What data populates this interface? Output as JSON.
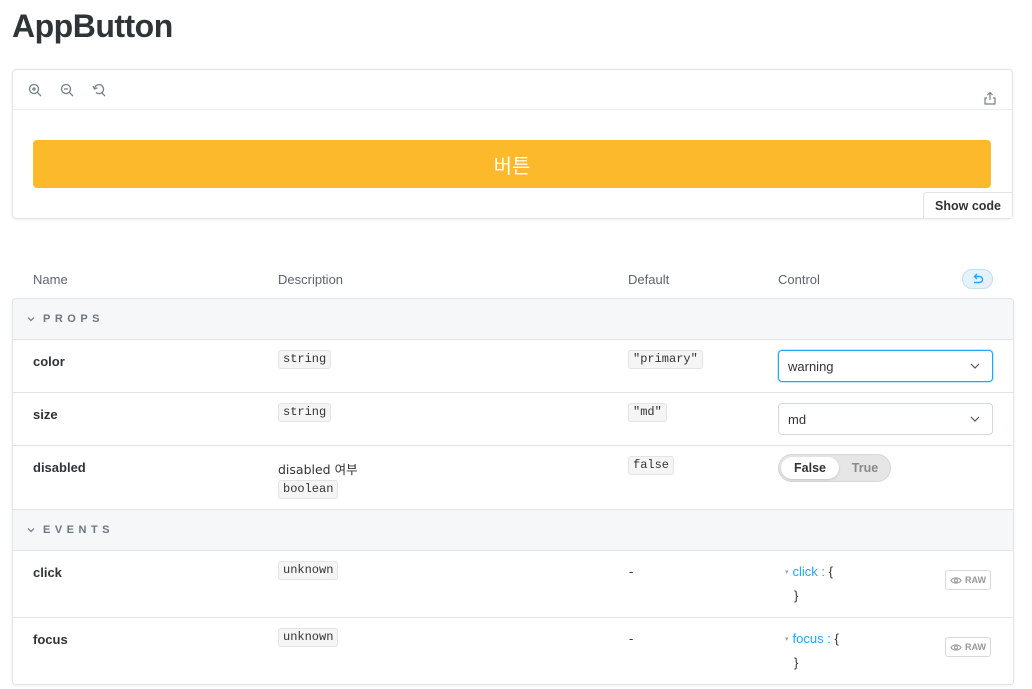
{
  "page": {
    "title": "AppButton"
  },
  "canvas": {
    "toolbar": {
      "zoom_in": "zoom-in-icon",
      "zoom_out": "zoom-out-icon",
      "reset_zoom": "reset-zoom-icon",
      "share": "share-icon"
    },
    "preview_button_label": "버튼",
    "show_code_label": "Show code",
    "colors": {
      "button_bg": "#fdb92c",
      "accent": "#1ea7fd"
    }
  },
  "argstable": {
    "headers": {
      "name": "Name",
      "description": "Description",
      "default": "Default",
      "control": "Control"
    },
    "reset_icon": "undo-icon",
    "sections": {
      "props": "PROPS",
      "events": "EVENTS"
    },
    "props": [
      {
        "name": "color",
        "type": "string",
        "default": "\"primary\"",
        "control_value": "warning"
      },
      {
        "name": "size",
        "type": "string",
        "default": "\"md\"",
        "control_value": "md"
      },
      {
        "name": "disabled",
        "description": "disabled 여부",
        "type": "boolean",
        "default": "false",
        "toggle_false": "False",
        "toggle_true": "True",
        "toggle_selected": "False"
      }
    ],
    "events": [
      {
        "name": "click",
        "type": "unknown",
        "default": "-",
        "obj_key": "click",
        "obj_open": ":",
        "brace_open": "{",
        "brace_close": "}",
        "raw_label": "RAW"
      },
      {
        "name": "focus",
        "type": "unknown",
        "default": "-",
        "obj_key": "focus",
        "obj_open": ":",
        "brace_open": "{",
        "brace_close": "}",
        "raw_label": "RAW"
      }
    ]
  }
}
